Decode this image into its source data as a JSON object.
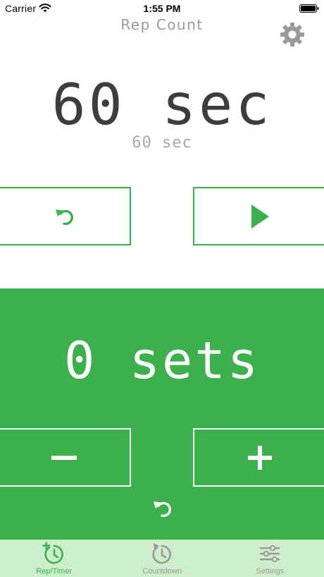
{
  "status_bar": {
    "carrier": "Carrier",
    "time": "1:55 PM"
  },
  "header": {
    "title": "Rep Count",
    "settings_icon": "gear-icon"
  },
  "timer": {
    "value": 60,
    "unit": "sec",
    "display": "60 sec",
    "sub_display": "60 sec",
    "reset_icon": "undo-icon",
    "play_icon": "play-icon"
  },
  "sets": {
    "count": 0,
    "display": "0 sets",
    "decrement_label": "−",
    "increment_label": "+",
    "reset_icon": "undo-icon"
  },
  "tab_bar": {
    "items": [
      {
        "label": "Rep/Timer",
        "icon": "timer-add-icon",
        "active": true
      },
      {
        "label": "Countdown",
        "icon": "countdown-icon",
        "active": false
      },
      {
        "label": "Settings",
        "icon": "sliders-icon",
        "active": false
      }
    ]
  },
  "colors": {
    "accent": "#3bb04b",
    "tab_bar_bg": "#cdeecb",
    "timer_text": "#3d3d3d",
    "muted_text": "#9a9a9a"
  }
}
